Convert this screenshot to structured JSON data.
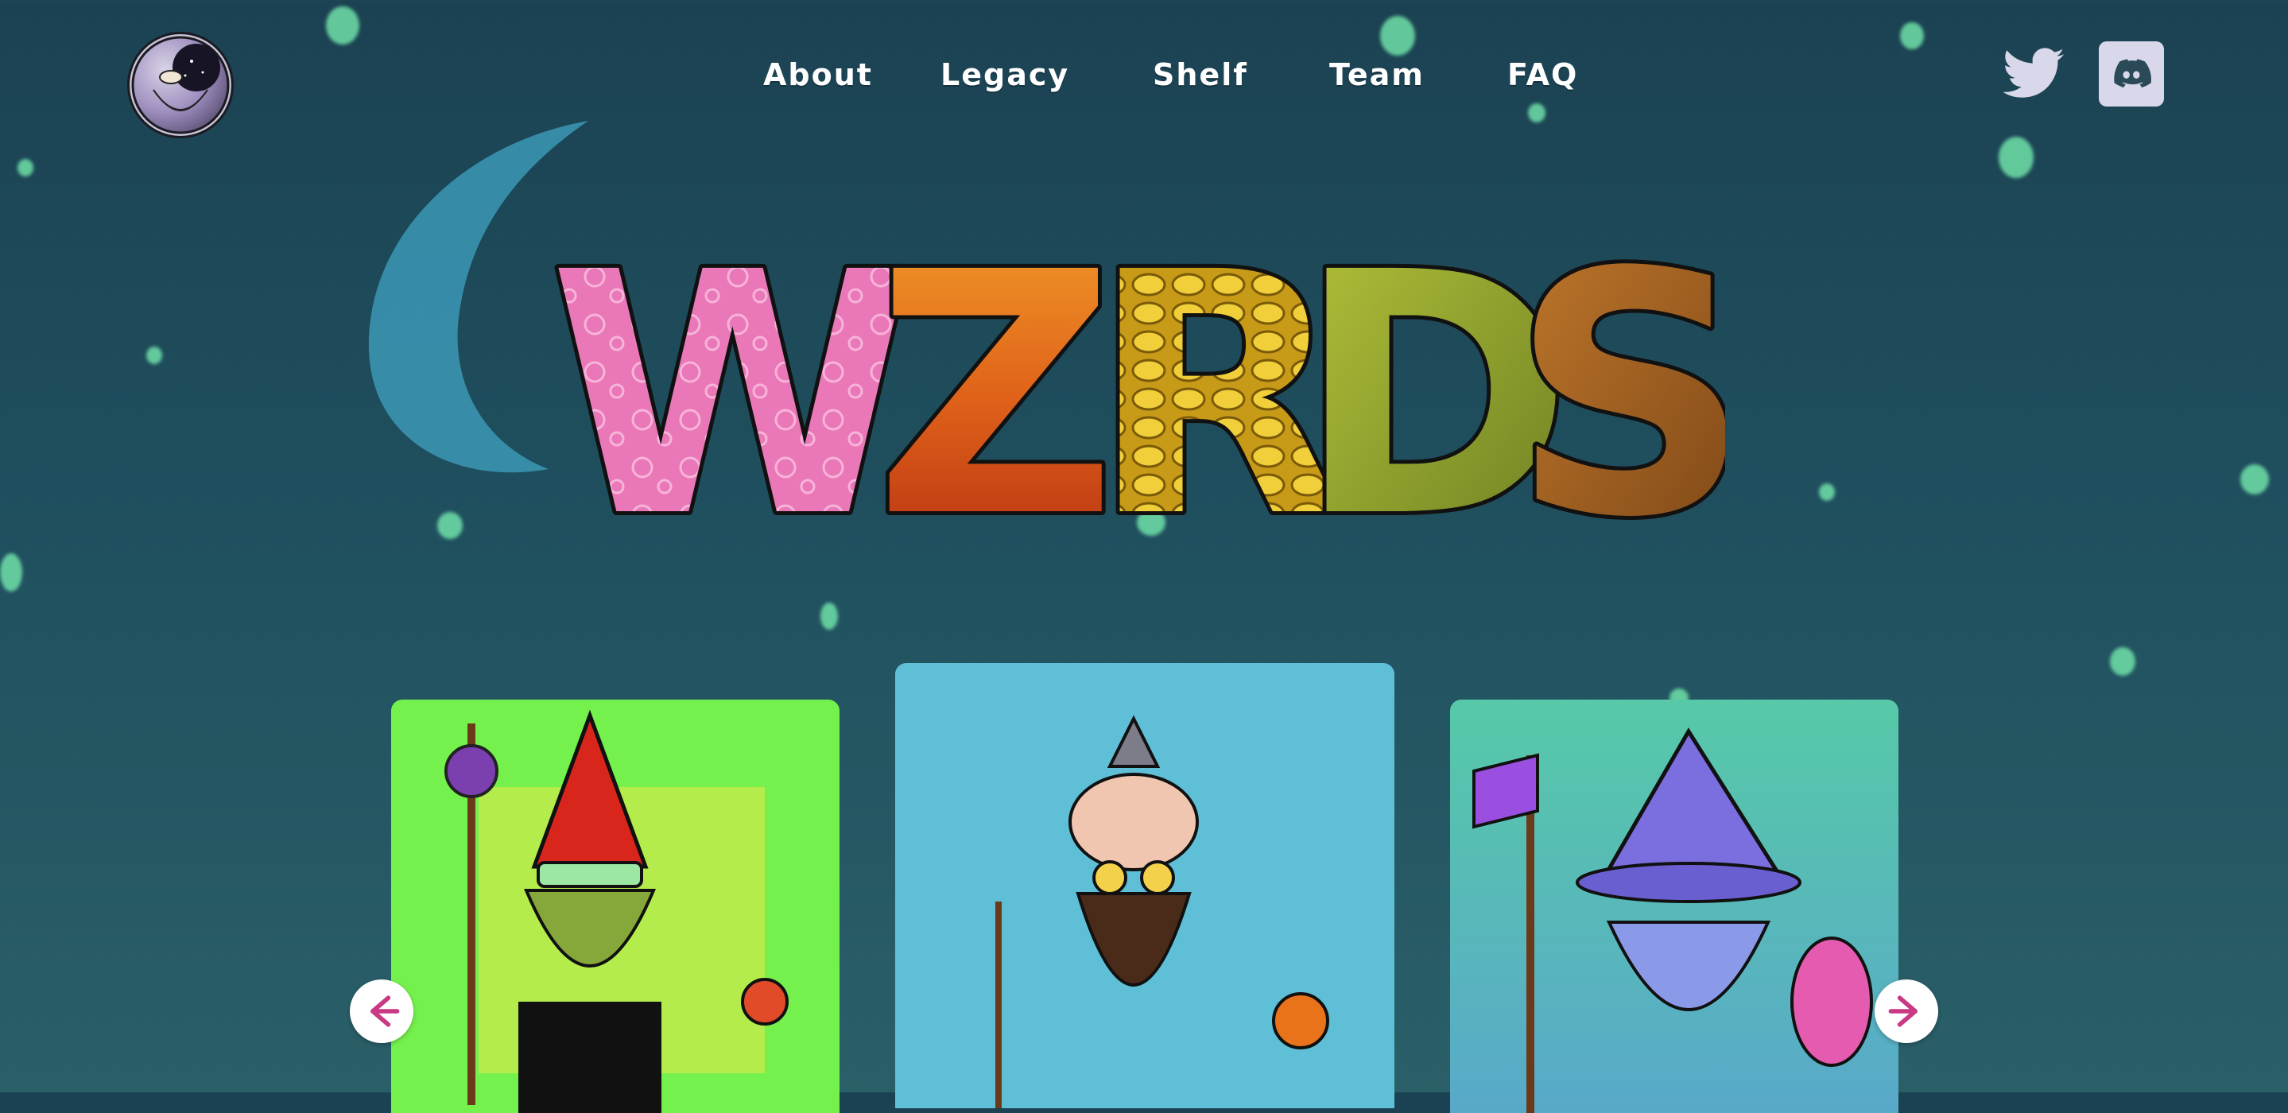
{
  "brand": {
    "logo_icon": "wizard-avatar-logo-icon"
  },
  "nav": {
    "items": [
      {
        "label": "About"
      },
      {
        "label": "Legacy"
      },
      {
        "label": "Shelf"
      },
      {
        "label": "Team"
      },
      {
        "label": "FAQ"
      }
    ]
  },
  "social": {
    "twitter_icon": "twitter-icon",
    "discord_icon": "discord-icon"
  },
  "hero": {
    "title": "WZRDS",
    "letters": [
      "W",
      "Z",
      "R",
      "D",
      "S"
    ],
    "letter_fills": [
      "#ea78b9",
      "#e0621a",
      "#e6c12f",
      "#8fa52e",
      "#9a5a1f"
    ],
    "moon_color": "#3a93b0"
  },
  "carousel": {
    "prev_icon": "arrow-left-icon",
    "next_icon": "arrow-right-icon",
    "arrow_color": "#c93a85",
    "cards": [
      {
        "name": "gnome-wizard-skeleton-card",
        "bg": "#74f14c"
      },
      {
        "name": "bearded-wizard-pumpkin-card",
        "bg": "#5ebfd7"
      },
      {
        "name": "purple-hat-wizard-card",
        "bg": "#58b6b8"
      }
    ]
  }
}
